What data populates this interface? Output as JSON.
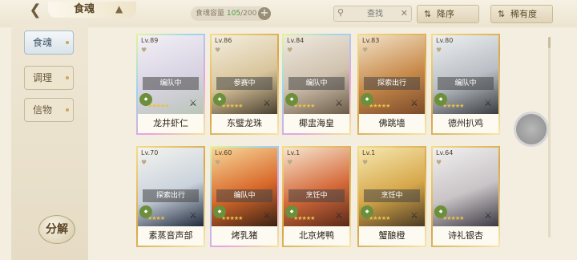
{
  "header": {
    "title": "食魂",
    "capacity_label": "食魂容量",
    "capacity_used": "105",
    "capacity_total": "/200",
    "search_placeholder": "查找",
    "sort_order_label": "降序",
    "sort_rarity_label": "稀有度"
  },
  "sidebar": {
    "tabs": [
      {
        "label": "食魂",
        "active": true
      },
      {
        "label": "调理",
        "active": false
      },
      {
        "label": "信物",
        "active": false
      }
    ],
    "decompose_label": "分解"
  },
  "cards": [
    {
      "level": "Lv.89",
      "name": "龙井虾仁",
      "status": "编队中",
      "stars": 5
    },
    {
      "level": "Lv.86",
      "name": "东璧龙珠",
      "status": "参赛中",
      "stars": 5
    },
    {
      "level": "Lv.84",
      "name": "椰盅海皇",
      "status": "编队中",
      "stars": 5
    },
    {
      "level": "Lv.83",
      "name": "佛跳墙",
      "status": "探索出行",
      "stars": 5
    },
    {
      "level": "Lv.80",
      "name": "德州扒鸡",
      "status": "编队中",
      "stars": 5
    },
    {
      "level": "Lv.70",
      "name": "素蒸音声部",
      "status": "探索出行",
      "stars": 4
    },
    {
      "level": "Lv.60",
      "name": "烤乳猪",
      "status": "编队中",
      "stars": 5
    },
    {
      "level": "Lv.1",
      "name": "北京烤鸭",
      "status": "烹饪中",
      "stars": 5
    },
    {
      "level": "Lv.1",
      "name": "蟹酿橙",
      "status": "烹饪中",
      "stars": 5
    },
    {
      "level": "Lv.64",
      "name": "诗礼银杏",
      "status": "",
      "stars": 5
    }
  ]
}
